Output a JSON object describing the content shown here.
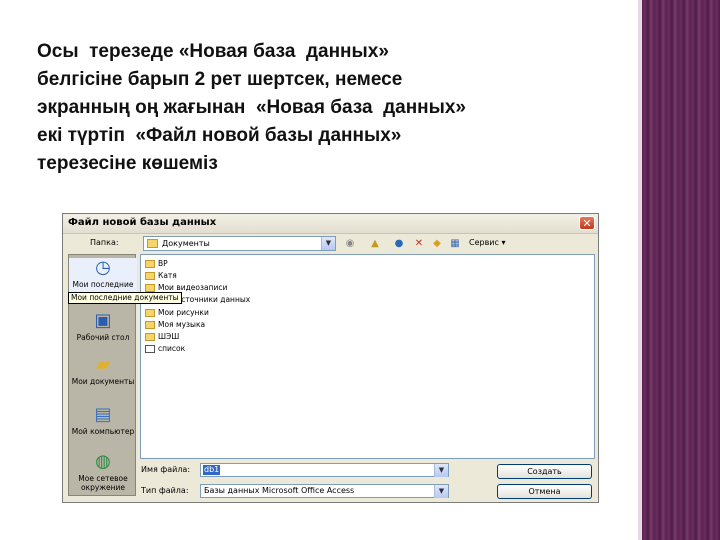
{
  "slide": {
    "lines": [
      "Осы  терезеде «Новая база  данных»",
      "белгісіне барып 2 рет шертсек, немесе",
      "экранның оң жағынан  «Новая база  данных»",
      "екі түртіп  «Файл новой базы данных»",
      "терезесіне көшеміз"
    ]
  },
  "dialog": {
    "title": "Файл новой базы данных",
    "close_glyph": "✕",
    "look_in_label": "Папка:",
    "look_in_value": "Документы",
    "toolbar": {
      "back_glyph": "◉",
      "up_glyph": "▲",
      "search_glyph": "●",
      "delete_glyph": "✕",
      "newfolder_glyph": "◆",
      "views_glyph": "▦",
      "service_label": "Сервис ▾"
    },
    "places": [
      {
        "label": "Мои последние",
        "icon": "clock-icon",
        "glyph": "◷"
      },
      {
        "label": "Рабочий стол",
        "icon": "desktop-icon",
        "glyph": "▣"
      },
      {
        "label": "Мои документы",
        "icon": "documents-folder-icon",
        "glyph": "▰"
      },
      {
        "label": "Мой компьютер",
        "icon": "computer-icon",
        "glyph": "▤"
      },
      {
        "label": "Мое сетевое окружение",
        "icon": "network-icon",
        "glyph": "◍"
      }
    ],
    "tooltip": "Мои последние документы",
    "files": [
      {
        "name": "ВР",
        "kind": "folder"
      },
      {
        "name": "Катя",
        "kind": "folder"
      },
      {
        "name": "Мои видеозаписи",
        "kind": "folder"
      },
      {
        "name": "Мои источники данных",
        "kind": "folder"
      },
      {
        "name": "Мои рисунки",
        "kind": "folder"
      },
      {
        "name": "Моя музыка",
        "kind": "folder"
      },
      {
        "name": "ШЭШ",
        "kind": "folder"
      },
      {
        "name": "список",
        "kind": "file"
      }
    ],
    "file_name_label": "Имя файла:",
    "file_name_value": "db1",
    "file_type_label": "Тип файла:",
    "file_type_value": "Базы данных Microsoft Office Access",
    "create_button": "Создать",
    "cancel_button": "Отмена",
    "arrow_glyph": "▼"
  }
}
